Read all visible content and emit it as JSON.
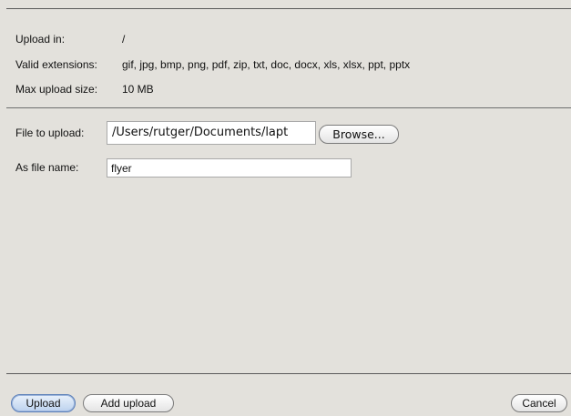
{
  "info": {
    "upload_in_label": "Upload in:",
    "upload_in_value": "/",
    "valid_extensions_label": "Valid extensions:",
    "valid_extensions_value": "gif, jpg, bmp, png, pdf, zip, txt, doc, docx, xls, xlsx, ppt, pptx",
    "max_upload_size_label": "Max upload size:",
    "max_upload_size_value": "10 MB"
  },
  "form": {
    "file_to_upload_label": "File to upload:",
    "file_path_value": "/Users/rutger/Documents/lapt",
    "browse_label": "Browse...",
    "as_file_name_label": "As file name:",
    "file_name_value": "flyer"
  },
  "footer": {
    "upload_label": "Upload",
    "add_upload_label": "Add upload",
    "cancel_label": "Cancel"
  }
}
